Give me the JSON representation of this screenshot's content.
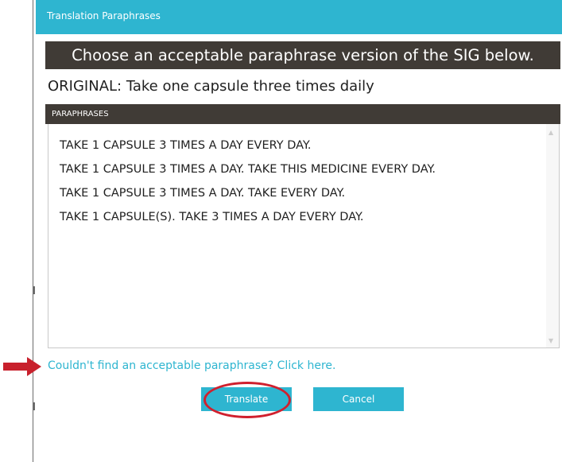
{
  "window": {
    "title": "Translation Paraphrases"
  },
  "instruction": "Choose an acceptable paraphrase version of the SIG below.",
  "original": "ORIGINAL: Take one capsule three times daily",
  "paraphrases": {
    "header": "PARAPHRASES",
    "items": [
      "TAKE 1 CAPSULE 3 TIMES A DAY EVERY DAY.",
      "TAKE 1 CAPSULE 3 TIMES A DAY. TAKE THIS MEDICINE EVERY DAY.",
      "TAKE 1 CAPSULE 3 TIMES A DAY. TAKE EVERY DAY.",
      "TAKE 1 CAPSULE(S). TAKE 3 TIMES A DAY EVERY DAY."
    ]
  },
  "help_link": "Couldn't find an acceptable paraphrase? Click here.",
  "buttons": {
    "translate": "Translate",
    "cancel": "Cancel"
  },
  "colors": {
    "accent": "#2eb5d0",
    "header_dark": "#403b36",
    "annotation_red": "#d0202e"
  },
  "icons": {
    "pointer": "right-arrow-icon",
    "scroll_up": "scroll-up-icon",
    "scroll_down": "scroll-down-icon"
  }
}
